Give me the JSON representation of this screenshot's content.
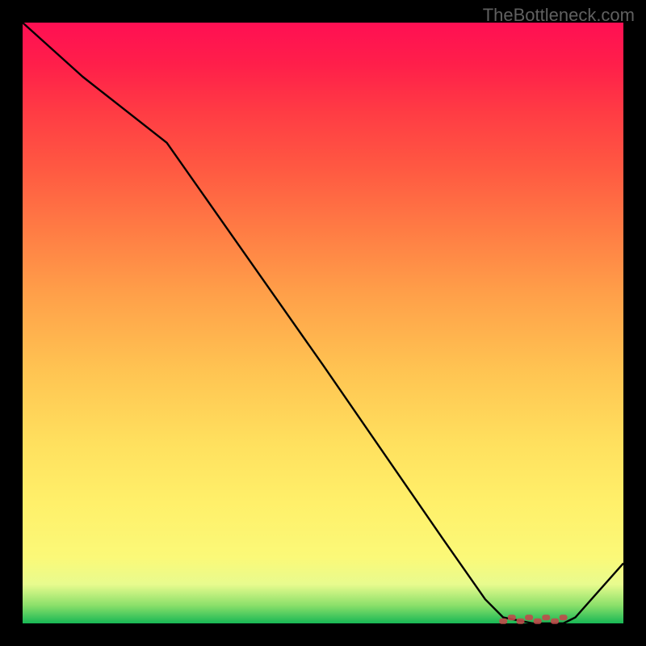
{
  "watermark": "TheBottleneck.com",
  "chart_data": {
    "type": "line",
    "title": "",
    "xlabel": "",
    "ylabel": "",
    "xlim": [
      0,
      100
    ],
    "ylim": [
      0,
      100
    ],
    "series": [
      {
        "name": "curve",
        "x": [
          0,
          10,
          24,
          50,
          70,
          77,
          80,
          85,
          90,
          92,
          100
        ],
        "y": [
          100,
          91,
          80,
          43,
          14,
          4,
          1,
          0,
          0,
          1,
          10
        ]
      }
    ],
    "marker_region": {
      "x_start": 80,
      "x_end": 90,
      "y": 0,
      "count": 8
    }
  }
}
